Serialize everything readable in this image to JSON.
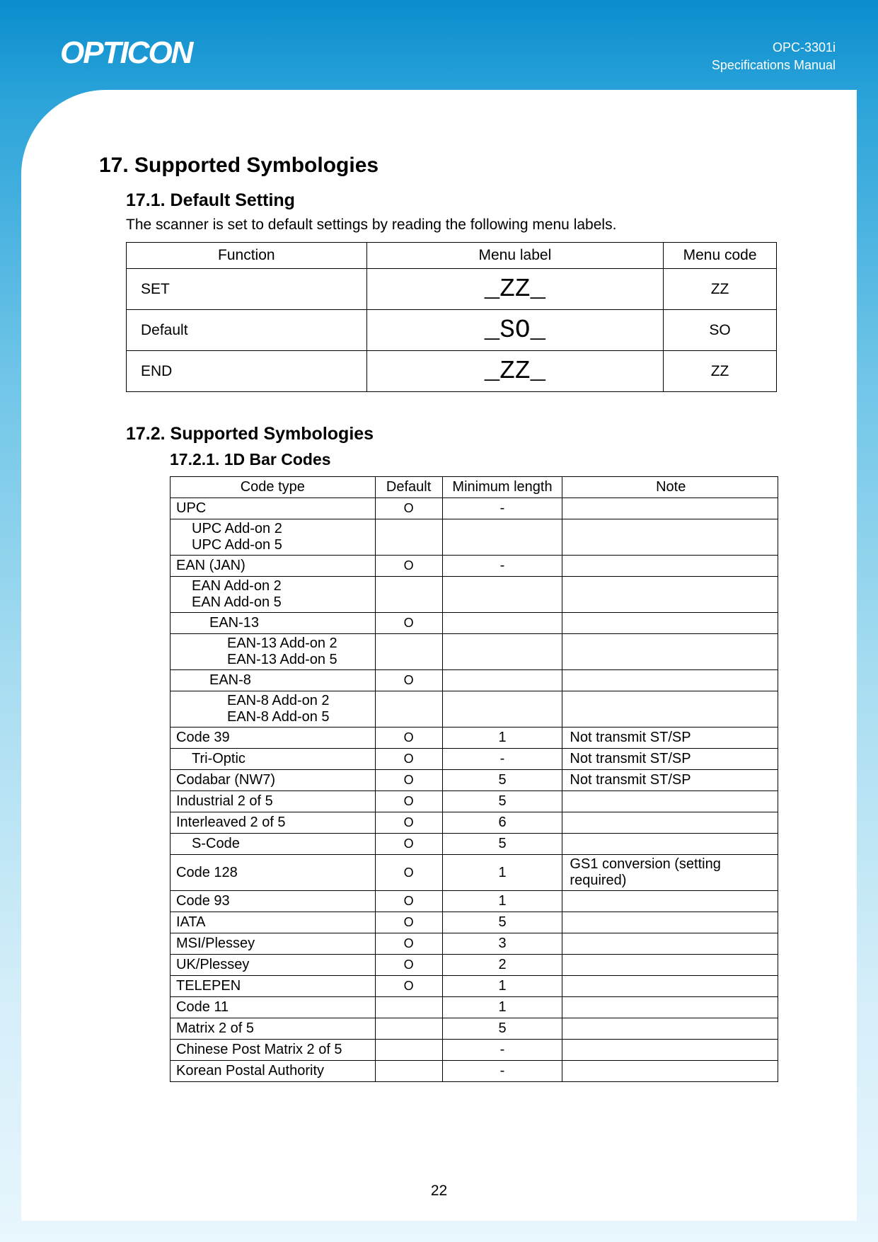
{
  "header": {
    "brand": "OPTICON",
    "model": "OPC-3301i",
    "doc": "Specifications Manual"
  },
  "section": {
    "h1": "17. Supported Symbologies",
    "h2a": "17.1. Default Setting",
    "intro": "The scanner is set to default settings by reading the following menu labels.",
    "h2b": "17.2. Supported Symbologies",
    "h3": "17.2.1. 1D Bar Codes"
  },
  "menu_table": {
    "headers": {
      "func": "Function",
      "label": "Menu label",
      "code": "Menu code"
    },
    "rows": [
      {
        "func": "SET",
        "label": "_ZZ_",
        "code": "ZZ"
      },
      {
        "func": "Default",
        "label": "_SO_",
        "code": "SO"
      },
      {
        "func": "END",
        "label": "_ZZ_",
        "code": "ZZ"
      }
    ]
  },
  "sym_table": {
    "headers": {
      "type": "Code type",
      "def": "Default",
      "min": "Minimum length",
      "note": "Note"
    },
    "circle": "O",
    "rows": [
      {
        "type": "UPC",
        "indent": 0,
        "def": true,
        "min": "-",
        "note": ""
      },
      {
        "type": "UPC Add-on 2\nUPC Add-on 5",
        "indent": 1,
        "def": false,
        "min": "",
        "note": ""
      },
      {
        "type": "EAN (JAN)",
        "indent": 0,
        "def": true,
        "min": "-",
        "note": ""
      },
      {
        "type": "EAN Add-on 2\nEAN Add-on 5",
        "indent": 1,
        "def": false,
        "min": "",
        "note": ""
      },
      {
        "type": "EAN-13",
        "indent": 2,
        "def": true,
        "min": "",
        "note": ""
      },
      {
        "type": "EAN-13 Add-on 2\nEAN-13 Add-on 5",
        "indent": 3,
        "def": false,
        "min": "",
        "note": ""
      },
      {
        "type": "EAN-8",
        "indent": 2,
        "def": true,
        "min": "",
        "note": ""
      },
      {
        "type": "EAN-8 Add-on 2\nEAN-8 Add-on 5",
        "indent": 3,
        "def": false,
        "min": "",
        "note": ""
      },
      {
        "type": "Code 39",
        "indent": 0,
        "def": true,
        "min": "1",
        "note": "Not transmit ST/SP"
      },
      {
        "type": "Tri-Optic",
        "indent": 1,
        "def": true,
        "min": "-",
        "note": "Not transmit ST/SP"
      },
      {
        "type": "Codabar (NW7)",
        "indent": 0,
        "def": true,
        "min": "5",
        "note": "Not transmit ST/SP"
      },
      {
        "type": "Industrial 2 of 5",
        "indent": 0,
        "def": true,
        "min": "5",
        "note": ""
      },
      {
        "type": "Interleaved 2 of 5",
        "indent": 0,
        "def": true,
        "min": "6",
        "note": ""
      },
      {
        "type": "S-Code",
        "indent": 1,
        "def": true,
        "min": "5",
        "note": ""
      },
      {
        "type": "Code 128",
        "indent": 0,
        "def": true,
        "min": "1",
        "note": "GS1 conversion (setting required)"
      },
      {
        "type": "Code 93",
        "indent": 0,
        "def": true,
        "min": "1",
        "note": ""
      },
      {
        "type": "IATA",
        "indent": 0,
        "def": true,
        "min": "5",
        "note": ""
      },
      {
        "type": "MSI/Plessey",
        "indent": 0,
        "def": true,
        "min": "3",
        "note": ""
      },
      {
        "type": "UK/Plessey",
        "indent": 0,
        "def": true,
        "min": "2",
        "note": ""
      },
      {
        "type": "TELEPEN",
        "indent": 0,
        "def": true,
        "min": "1",
        "note": ""
      },
      {
        "type": "Code 11",
        "indent": 0,
        "def": false,
        "min": "1",
        "note": ""
      },
      {
        "type": "Matrix 2 of 5",
        "indent": 0,
        "def": false,
        "min": "5",
        "note": ""
      },
      {
        "type": "Chinese Post Matrix 2 of 5",
        "indent": 0,
        "def": false,
        "min": "-",
        "note": ""
      },
      {
        "type": "Korean Postal Authority",
        "indent": 0,
        "def": false,
        "min": "-",
        "note": ""
      }
    ]
  },
  "page_number": "22"
}
